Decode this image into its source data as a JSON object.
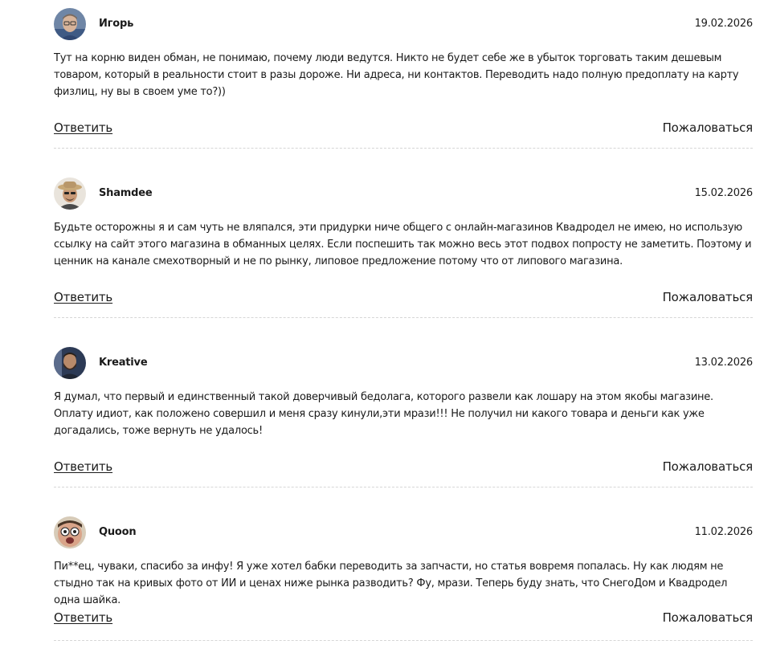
{
  "comments": [
    {
      "author": "Игорь",
      "date": "19.02.2026",
      "avatar_icon": "man-with-glasses-avatar",
      "text": "Тут на корню виден обман, не понимаю, почему люди ведутся. Никто не будет себе же в убыток торговать таким дешевым товаром, который в реальности стоит в разы дороже. Ни адреса, ни контактов. Переводить надо полную предоплату на карту физлиц, ну вы в своем уме то?))",
      "reply_label": "Ответить",
      "report_label": "Пожаловаться"
    },
    {
      "author": "Shamdee",
      "date": "15.02.2026",
      "avatar_icon": "man-with-hat-avatar",
      "text": "Будьте осторожны я и сам чуть не вляпался, эти придурки ниче общего с онлайн-магазинов Квадродел не имею, но использую ссылку на сайт этого магазина в обманных целях. Если поспешить так можно весь этот подвох попросту не заметить. Поэтому и ценник на канале смехотворный и не по рынку, липовое предложение потому что от липового магазина.",
      "reply_label": "Ответить",
      "report_label": "Пожаловаться"
    },
    {
      "author": "Kreative",
      "date": "13.02.2026",
      "avatar_icon": "bearded-man-avatar",
      "text": "Я думал, что первый и единственный такой доверчивый бедолага, которого развели как лошару на этом якобы магазине. Оплату идиот, как положено совершил и меня сразу кинули,эти мрази!!! Не получил ни какого товара и деньги как уже догадались, тоже вернуть не удалось!",
      "reply_label": "Ответить",
      "report_label": "Пожаловаться"
    },
    {
      "author": "Quoon",
      "date": "11.02.2026",
      "avatar_icon": "surprised-face-avatar",
      "text": "Пи**ец, чуваки, спасибо за инфу! Я уже хотел бабки переводить за запчасти, но статья вовремя попалась. Ну как людям не стыдно так на кривых фото от ИИ и ценах ниже рынка разводить? Фу, мрази. Теперь буду знать, что СнегоДом и Квадродел одна шайка.",
      "reply_label": "Ответить",
      "report_label": "Пожаловаться"
    }
  ]
}
